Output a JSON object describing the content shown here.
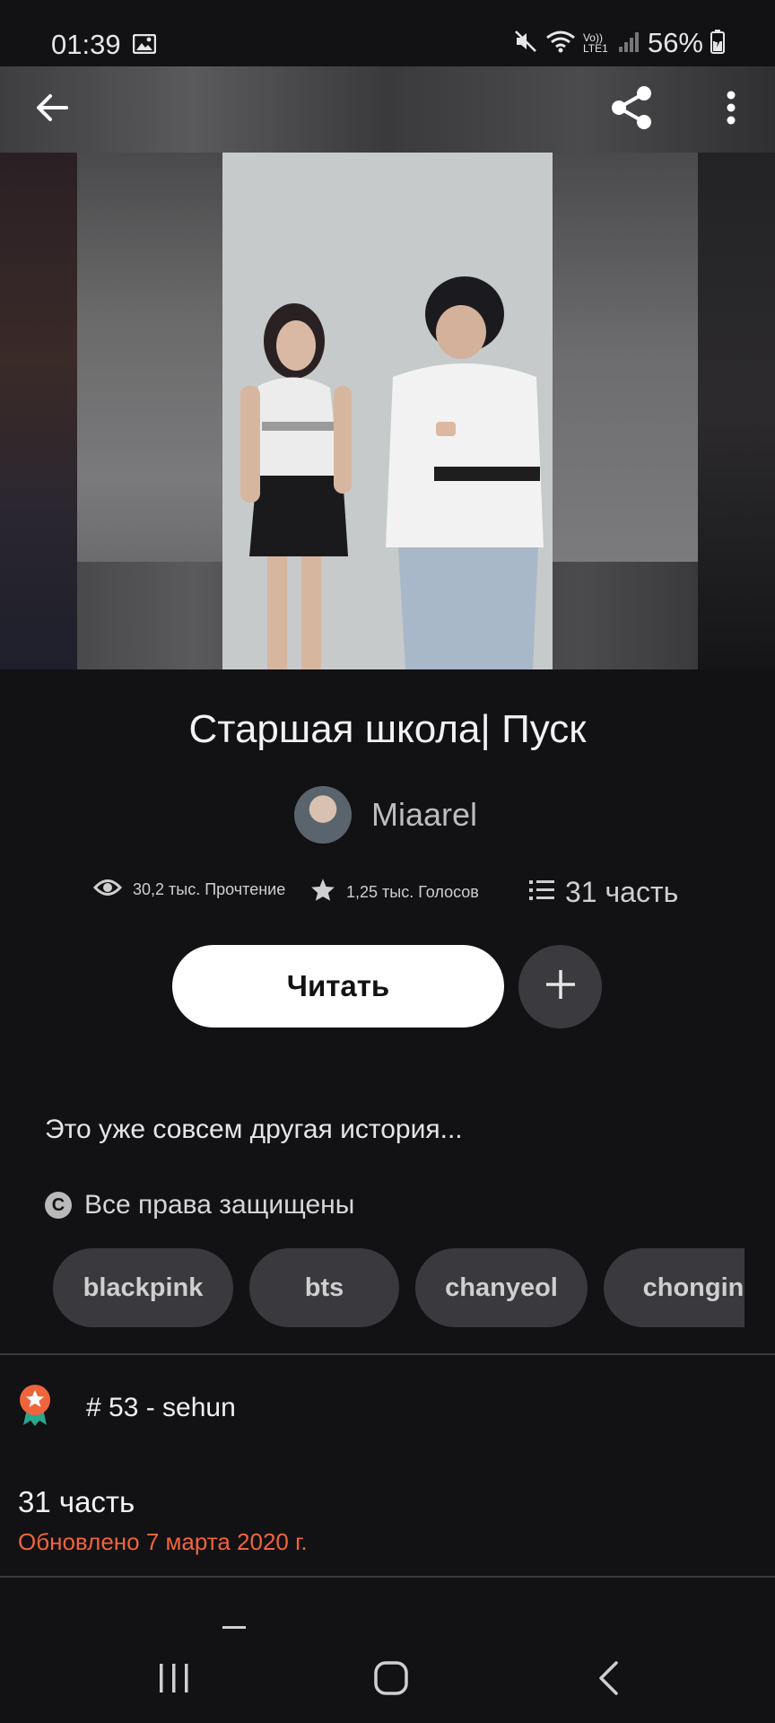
{
  "status_bar": {
    "time": "01:39",
    "battery_percent": "56%",
    "network_label": "Vo)) LTE1",
    "icons": [
      "gallery-icon",
      "mute-icon",
      "wifi-icon",
      "signal-icon",
      "battery-icon"
    ]
  },
  "toolbar": {
    "back_icon": "arrow-left-icon",
    "share_icon": "share-icon",
    "more_icon": "more-vertical-icon"
  },
  "story": {
    "title": "Старшая школа| Пуск",
    "author": "Miaarel",
    "reads": "30,2 тыс. Прочтение",
    "votes": "1,25 тыс. Голосов",
    "parts": "31 часть",
    "description": "Это уже совсем другая история...",
    "copyright": "Все права защищены"
  },
  "actions": {
    "read_label": "Читать",
    "add_icon": "plus-icon"
  },
  "tags": [
    "blackpink",
    "bts",
    "chanyeol",
    "chongin"
  ],
  "ranking": {
    "text": "# 53 - sehun",
    "icon": "award-badge-icon"
  },
  "table_of_contents": {
    "title": "31 часть",
    "updated": "Обновлено 7 марта 2020 г."
  },
  "colors": {
    "background": "#121114",
    "accent_orange": "#f0643c",
    "chip_background": "#3a393d"
  },
  "nav_bar": {
    "icons": [
      "recents-icon",
      "home-icon",
      "back-icon"
    ]
  }
}
